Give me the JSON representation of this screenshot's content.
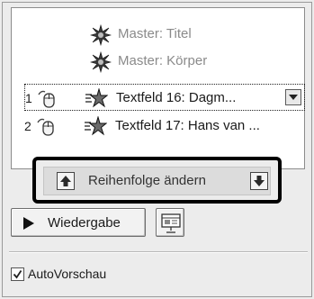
{
  "animation_list": {
    "items": [
      {
        "number": "",
        "label": "Master: Titel",
        "type": "master",
        "icon": "star-burst-icon"
      },
      {
        "number": "",
        "label": "Master: Körper",
        "type": "master",
        "icon": "star-burst-icon"
      },
      {
        "number": "1",
        "label": "Textfeld 16: Dagm...",
        "type": "entry",
        "icon": "star-entrance-icon",
        "trigger_icon": "mouse-click-icon",
        "selected": true
      },
      {
        "number": "2",
        "label": "Textfeld 17: Hans van ...",
        "type": "entry",
        "icon": "star-entrance-icon",
        "trigger_icon": "mouse-click-icon",
        "selected": false
      }
    ]
  },
  "reorder": {
    "label": "Reihenfolge ändern",
    "up_icon": "arrow-up-icon",
    "down_icon": "arrow-down-icon"
  },
  "playback": {
    "play_label": "Wiedergabe",
    "slideshow_icon": "slideshow-icon"
  },
  "autopreview": {
    "label": "AutoVorschau",
    "checked": true
  }
}
